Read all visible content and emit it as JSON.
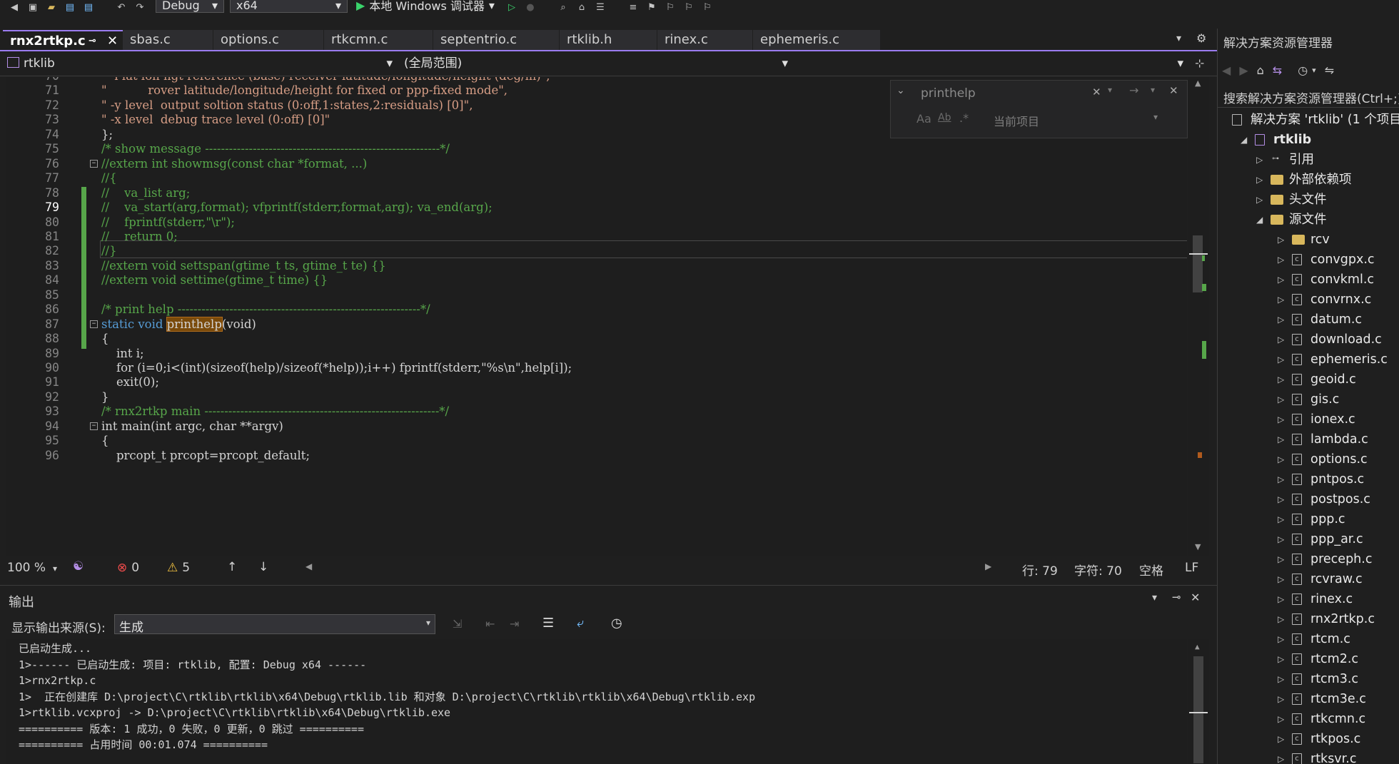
{
  "toolbar": {
    "config": "Debug",
    "platform": "x64",
    "run_label": "本地 Windows 调试器"
  },
  "tabs": [
    {
      "label": "rnx2rtkp.c",
      "active": true
    },
    {
      "label": "sbas.c"
    },
    {
      "label": "options.c"
    },
    {
      "label": "rtkcmn.c"
    },
    {
      "label": "septentrio.c"
    },
    {
      "label": "rtklib.h"
    },
    {
      "label": "rinex.c"
    },
    {
      "label": "ephemeris.c"
    }
  ],
  "navbar": {
    "project": "rtklib",
    "scope": "(全局范围)"
  },
  "find": {
    "query": "printhelp",
    "scope": "当前项目",
    "opt_case": "Aa",
    "opt_word": "Ab",
    "opt_regex": ".*"
  },
  "code": {
    "current_line": 79,
    "lines": [
      {
        "n": "70",
        "t": "\" -l lat lon hgt reference (base) receiver latitude/longitude/height (deg/m)\","
      },
      {
        "n": "71",
        "t": "\"           rover latitude/longitude/height for fixed or ppp-fixed mode\","
      },
      {
        "n": "72",
        "t": "\" -y level  output soltion status (0:off,1:states,2:residuals) [0]\","
      },
      {
        "n": "73",
        "t": "\" -x level  debug trace level (0:off) [0]\""
      },
      {
        "n": "74",
        "t": "};"
      },
      {
        "n": "75",
        "t": "/* show message -----------------------------------------------------------*/"
      },
      {
        "n": "76",
        "t": "//extern int showmsg(const char *format, ...)"
      },
      {
        "n": "77",
        "t": "//{"
      },
      {
        "n": "78",
        "t": "//    va_list arg;"
      },
      {
        "n": "79",
        "t": "//    va_start(arg,format); vfprintf(stderr,format,arg); va_end(arg);"
      },
      {
        "n": "80",
        "t": "//    fprintf(stderr,\"\\r\");"
      },
      {
        "n": "81",
        "t": "//    return 0;"
      },
      {
        "n": "82",
        "t": "//}"
      },
      {
        "n": "83",
        "t": "//extern void settspan(gtime_t ts, gtime_t te) {}"
      },
      {
        "n": "84",
        "t": "//extern void settime(gtime_t time) {}"
      },
      {
        "n": "85",
        "t": ""
      },
      {
        "n": "86",
        "t": "/* print help -------------------------------------------------------------*/"
      },
      {
        "n": "87",
        "t_kw": "static void ",
        "t_fn": "printhelp",
        "t_rest": "(void)"
      },
      {
        "n": "88",
        "t": "{"
      },
      {
        "n": "89",
        "t": "    int i;"
      },
      {
        "n": "90",
        "t": "    for (i=0;i<(int)(sizeof(help)/sizeof(*help));i++) fprintf(stderr,\"%s\\n\",help[i]);"
      },
      {
        "n": "91",
        "t": "    exit(0);"
      },
      {
        "n": "92",
        "t": "}"
      },
      {
        "n": "93",
        "t": "/* rnx2rtkp main -----------------------------------------------------------*/"
      },
      {
        "n": "94",
        "t": "int main(int argc, char **argv)"
      },
      {
        "n": "95",
        "t": "{"
      },
      {
        "n": "96",
        "t": "    prcopt_t prcopt=prcopt_default;"
      }
    ]
  },
  "status": {
    "zoom": "100 %",
    "errors": "0",
    "warnings": "5",
    "line": "行: 79",
    "col": "字符: 70",
    "spaces": "空格",
    "eol": "LF"
  },
  "output": {
    "title": "输出",
    "source_label": "显示输出来源(S):",
    "source_value": "生成",
    "lines": [
      "已启动生成...",
      "1>------ 已启动生成: 项目: rtklib, 配置: Debug x64 ------",
      "1>rnx2rtkp.c",
      "1>  正在创建库 D:\\project\\C\\rtklib\\rtklib\\x64\\Debug\\rtklib.lib 和对象 D:\\project\\C\\rtklib\\rtklib\\x64\\Debug\\rtklib.exp",
      "1>rtklib.vcxproj -> D:\\project\\C\\rtklib\\rtklib\\x64\\Debug\\rtklib.exe",
      "========== 版本: 1 成功，0 失败，0 更新，0 跳过 ==========",
      "========== 占用时间 00:01.074 =========="
    ]
  },
  "solution": {
    "title": "解决方案资源管理器",
    "search": "搜索解决方案资源管理器(Ctrl+;)",
    "root": "解决方案 'rtklib' (1 个项目",
    "project": "rtklib",
    "nodes": [
      "引用",
      "外部依赖项",
      "头文件",
      "源文件"
    ],
    "folder": "rcv",
    "files": [
      "convgpx.c",
      "convkml.c",
      "convrnx.c",
      "datum.c",
      "download.c",
      "ephemeris.c",
      "geoid.c",
      "gis.c",
      "ionex.c",
      "lambda.c",
      "options.c",
      "pntpos.c",
      "postpos.c",
      "ppp.c",
      "ppp_ar.c",
      "preceph.c",
      "rcvraw.c",
      "rinex.c",
      "rnx2rtkp.c",
      "rtcm.c",
      "rtcm2.c",
      "rtcm3.c",
      "rtcm3e.c",
      "rtkcmn.c",
      "rtkpos.c",
      "rtksvr.c"
    ]
  }
}
